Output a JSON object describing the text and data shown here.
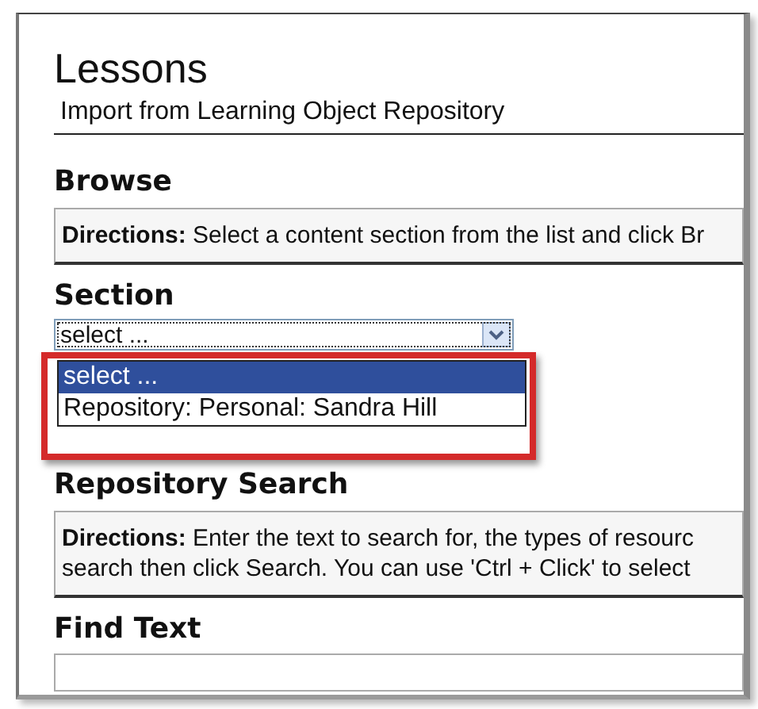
{
  "page": {
    "title": "Lessons",
    "subtitle": "Import from Learning Object Repository"
  },
  "browse": {
    "heading": "Browse",
    "directions": "**Directions:** Select a content section from the list and click Br"
  },
  "section": {
    "label": "Section",
    "value": "select ...",
    "options": [
      {
        "label": "select ...",
        "selected": true
      },
      {
        "label": "Repository: Personal: Sandra Hill",
        "selected": false
      }
    ]
  },
  "repository_search": {
    "heading": "Repository Search",
    "directions": [
      "**Directions:** Enter the text to search for, the types of resourc",
      "search then click Search. You can use 'Ctrl + Click' to select"
    ]
  },
  "find_text": {
    "label": "Find Text"
  }
}
